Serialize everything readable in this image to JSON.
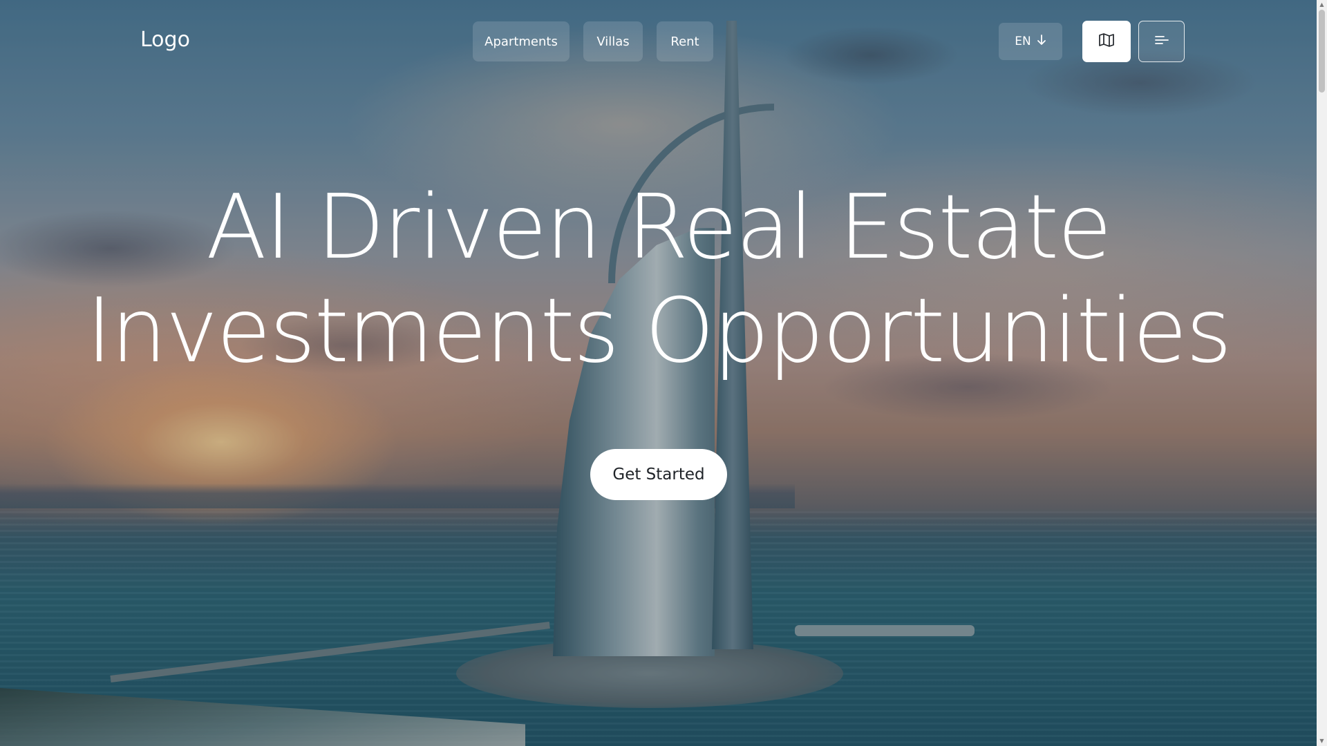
{
  "header": {
    "logo": "Logo",
    "nav": [
      {
        "label": "Apartments"
      },
      {
        "label": "Villas"
      },
      {
        "label": "Rent"
      }
    ],
    "language": {
      "selected": "EN",
      "icon": "arrow-down-icon"
    },
    "map_button_icon": "map-icon",
    "menu_button_icon": "menu-icon"
  },
  "hero": {
    "headline_line1": "AI Driven Real Estate",
    "headline_line2": "Investments Opportunities",
    "cta_label": "Get Started"
  },
  "colors": {
    "text": "#ffffff",
    "cta_bg": "#ffffff",
    "cta_text": "#1f2328",
    "nav_pill_bg": "rgba(255,255,255,0.14)"
  }
}
